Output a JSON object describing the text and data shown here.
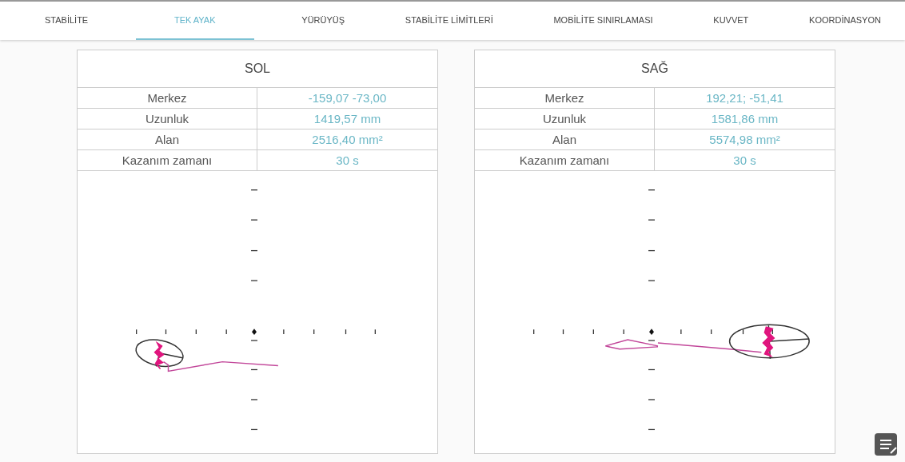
{
  "tabs": [
    {
      "label": "STABİLİTE",
      "selected": false
    },
    {
      "label": "TEK AYAK",
      "selected": true
    },
    {
      "label": "YÜRÜYÜŞ",
      "selected": false
    },
    {
      "label": "STABİLİTE LİMİTLERİ",
      "selected": false
    },
    {
      "label": "MOBİLİTE SINIRLAMASI",
      "selected": false
    },
    {
      "label": "KUVVET",
      "selected": false
    },
    {
      "label": "KOORDİNASYON",
      "selected": false
    }
  ],
  "panels": [
    {
      "title": "SOL",
      "rows": [
        {
          "label": "Merkez",
          "value": "-159,07 -73,00"
        },
        {
          "label": "Uzunluk",
          "value": "1419,57 mm"
        },
        {
          "label": "Alan",
          "value": "2516,40 mm²"
        },
        {
          "label": "Kazanım zamanı",
          "value": "30 s"
        }
      ]
    },
    {
      "title": "SAĞ",
      "rows": [
        {
          "label": "Merkez",
          "value": "192,21; -51,41"
        },
        {
          "label": "Uzunluk",
          "value": "1581,86 mm"
        },
        {
          "label": "Alan",
          "value": "5574,98 mm²"
        },
        {
          "label": "Kazanım zamanı",
          "value": "30 s"
        }
      ]
    }
  ]
}
